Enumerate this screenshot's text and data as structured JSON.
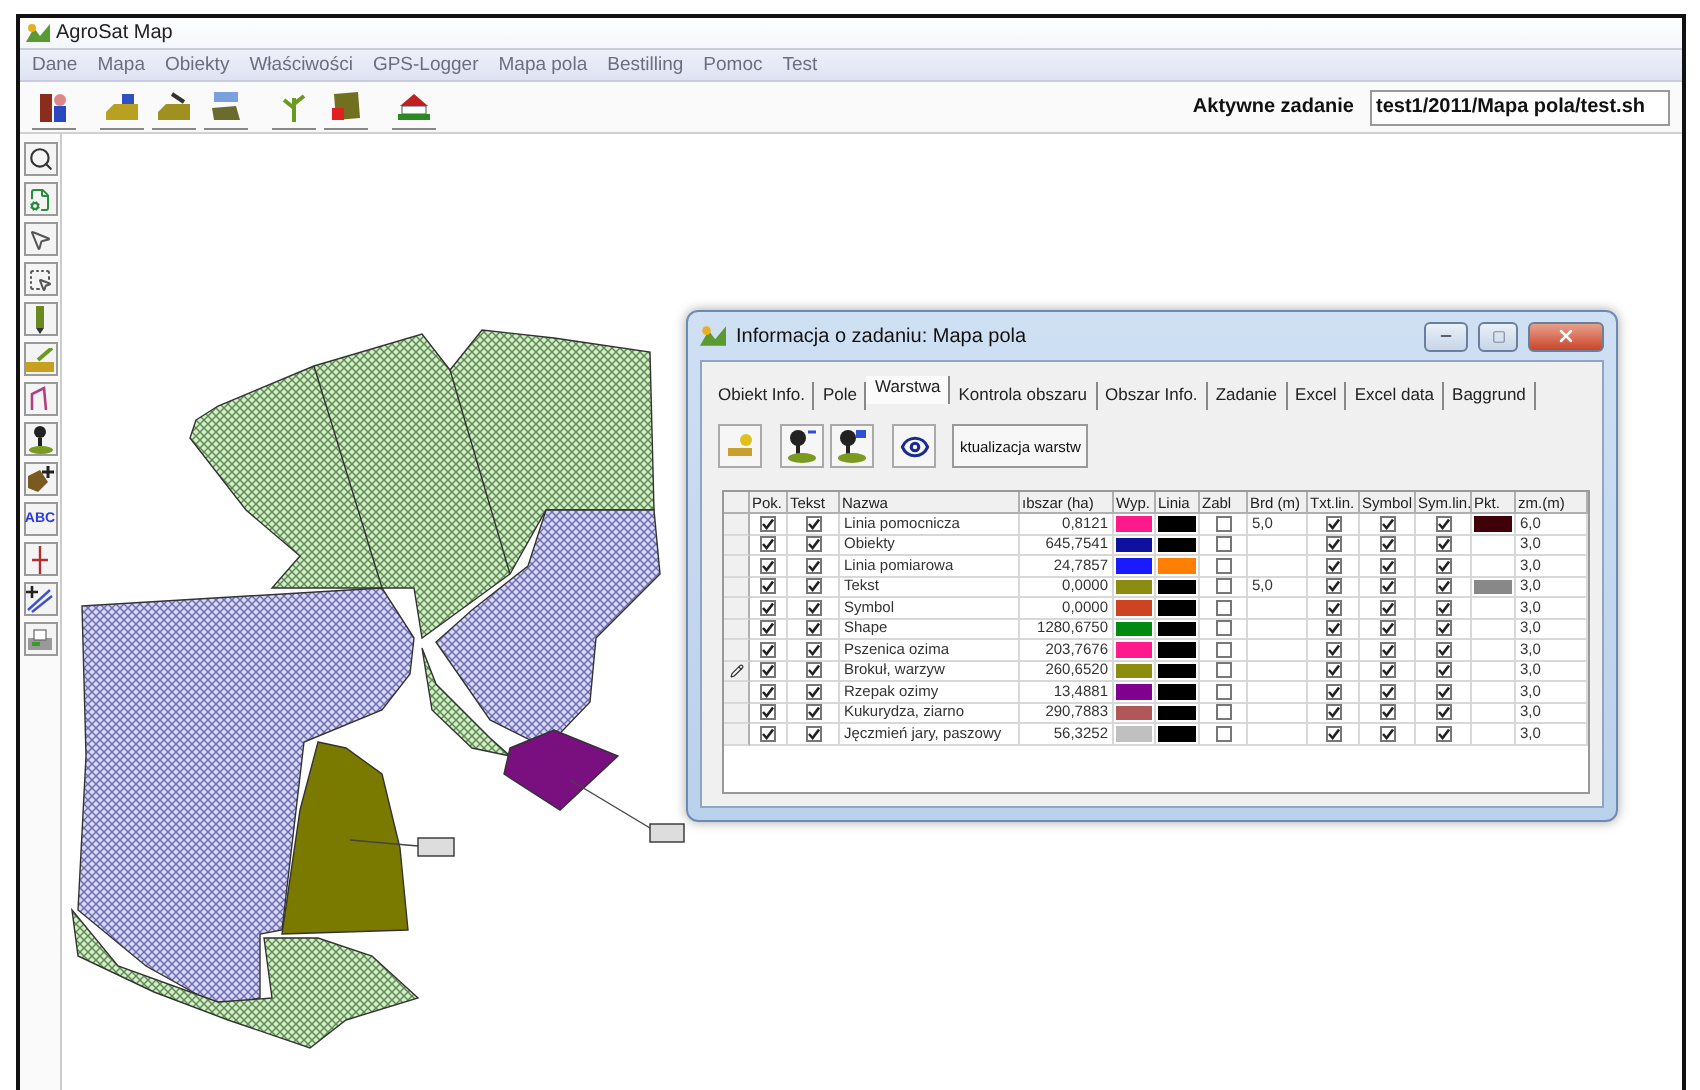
{
  "window": {
    "title": "AgroSat Map"
  },
  "menu": [
    "Dane",
    "Mapa",
    "Obiekty",
    "Właściwości",
    "GPS-Logger",
    "Mapa pola",
    "Bestilling",
    "Pomoc",
    "Test"
  ],
  "active_task": {
    "label": "Aktywne zadanie",
    "value": "test1/2011/Mapa pola/test.sh"
  },
  "side_toolbar": {
    "text_tool_label": "ABC"
  },
  "dialog": {
    "title": "Informacja o zadaniu: Mapa pola",
    "tabs": [
      {
        "label": "Obiekt Info.",
        "selected": false
      },
      {
        "label": "Pole",
        "selected": false
      },
      {
        "label": "Warstwa",
        "selected": true
      },
      {
        "label": "Kontrola obszaru",
        "selected": false
      },
      {
        "label": "Obszar Info.",
        "selected": false
      },
      {
        "label": "Zadanie",
        "selected": false
      },
      {
        "label": "Excel",
        "selected": false
      },
      {
        "label": "Excel data",
        "selected": false
      },
      {
        "label": "Baggrund",
        "selected": false
      }
    ],
    "update_button": "ktualizacja warstw",
    "table": {
      "columns": [
        "Pok.",
        "Tekst",
        "Nazwa",
        "ıbszar (ha)",
        "Wyp.",
        "Linia",
        "Zabl",
        "Brd (m)",
        "Txt.lin.",
        "Symbol",
        "Sym.lin.",
        "Pkt.",
        "zm.(m)"
      ],
      "rows": [
        {
          "editing": false,
          "show": true,
          "text": true,
          "name": "Linia pomocnicza",
          "area": "0,8121",
          "fill": {
            "color": "#ff1a8c"
          },
          "line": {
            "color": "#000000"
          },
          "locked": false,
          "border": "5,0",
          "txt_line": true,
          "symbol": true,
          "sym_line": true,
          "point": {
            "color": "#400008"
          },
          "size": "6,0"
        },
        {
          "editing": false,
          "show": true,
          "text": true,
          "name": "Obiekty",
          "area": "645,7541",
          "fill": {
            "color": "#1010a0"
          },
          "line": {
            "color": "#000000"
          },
          "locked": false,
          "txt_line": true,
          "symbol": true,
          "sym_line": true,
          "size": "3,0"
        },
        {
          "editing": false,
          "show": true,
          "text": true,
          "name": "Linia pomiarowa",
          "area": "24,7857",
          "fill": {
            "color": "#1a1aff"
          },
          "line": {
            "color": "#ff8000"
          },
          "locked": false,
          "txt_line": true,
          "symbol": true,
          "sym_line": true,
          "size": "3,0"
        },
        {
          "editing": false,
          "show": true,
          "text": true,
          "name": "Tekst",
          "area": "0,0000",
          "fill": {
            "color": "#8c8c10"
          },
          "line": {
            "color": "#000000"
          },
          "locked": false,
          "border": "5,0",
          "txt_line": true,
          "symbol": true,
          "sym_line": true,
          "point": {
            "color": "#888888"
          },
          "size": "3,0"
        },
        {
          "editing": false,
          "show": true,
          "text": true,
          "name": "Symbol",
          "area": "0,0000",
          "fill": {
            "color": "#cc4422"
          },
          "line": {
            "color": "#000000"
          },
          "locked": false,
          "txt_line": true,
          "symbol": true,
          "sym_line": true,
          "size": "3,0"
        },
        {
          "editing": false,
          "show": true,
          "text": true,
          "name": "Shape",
          "area": "1280,6750",
          "fill": {
            "color": "#008a10"
          },
          "line": {
            "color": "#000000"
          },
          "locked": false,
          "txt_line": true,
          "symbol": true,
          "sym_line": true,
          "size": "3,0"
        },
        {
          "editing": false,
          "show": true,
          "text": true,
          "name": "Pszenica ozima",
          "area": "203,7676",
          "fill": {
            "color": "#ff1a8c"
          },
          "line": {
            "color": "#000000"
          },
          "locked": false,
          "txt_line": true,
          "symbol": true,
          "sym_line": true,
          "size": "3,0"
        },
        {
          "editing": true,
          "show": true,
          "text": true,
          "name": "Brokuł, warzyw",
          "area": "260,6520",
          "fill": {
            "color": "#8c8c10"
          },
          "line": {
            "color": "#000000"
          },
          "locked": false,
          "txt_line": true,
          "symbol": true,
          "sym_line": true,
          "size": "3,0"
        },
        {
          "editing": false,
          "show": true,
          "text": true,
          "name": "Rzepak ozimy",
          "area": "13,4881",
          "fill": {
            "color": "#800090"
          },
          "line": {
            "color": "#000000"
          },
          "locked": false,
          "txt_line": true,
          "symbol": true,
          "sym_line": true,
          "size": "3,0"
        },
        {
          "editing": false,
          "show": true,
          "text": true,
          "name": "Kukurydza, ziarno",
          "area": "290,7883",
          "fill": {
            "color": "#b05858"
          },
          "line": {
            "color": "#000000"
          },
          "locked": false,
          "txt_line": true,
          "symbol": true,
          "sym_line": true,
          "size": "3,0"
        },
        {
          "editing": false,
          "show": true,
          "text": true,
          "name": "Jęczmień jary, paszowy",
          "area": "56,3252",
          "fill": {
            "color": "#c0c0c0"
          },
          "line": {
            "color": "#000000"
          },
          "locked": false,
          "txt_line": true,
          "symbol": true,
          "sym_line": true,
          "size": "3,0"
        }
      ]
    }
  }
}
